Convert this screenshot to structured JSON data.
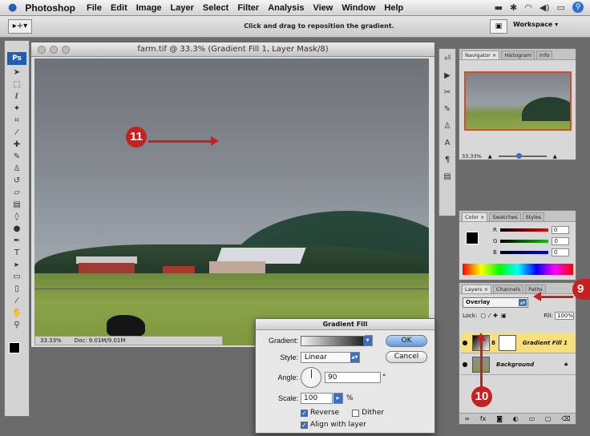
{
  "menubar": {
    "app": "Photoshop",
    "items": [
      "File",
      "Edit",
      "Image",
      "Layer",
      "Select",
      "Filter",
      "Analysis",
      "View",
      "Window",
      "Help"
    ]
  },
  "options_bar": {
    "hint": "Click and drag to reposition the gradient.",
    "workspace": "Workspace ▾"
  },
  "tools": {
    "ps_logo": "Ps"
  },
  "document": {
    "title": "farm.tif @ 33.3% (Gradient Fill 1, Layer Mask/8)",
    "zoom": "33.33%",
    "doc_size": "Doc: 9.01M/9.01M"
  },
  "navigator": {
    "tabs": [
      "Navigator ×",
      "Histogram",
      "Info"
    ],
    "zoom": "33.33%"
  },
  "color_panel": {
    "tabs": [
      "Color ×",
      "Swatches",
      "Styles"
    ],
    "channels": [
      {
        "label": "R",
        "value": "0"
      },
      {
        "label": "G",
        "value": "0"
      },
      {
        "label": "B",
        "value": "0"
      }
    ]
  },
  "layers_panel": {
    "tabs": [
      "Layers ×",
      "Channels",
      "Paths"
    ],
    "blend_mode": "Overlay",
    "lock_label": "Lock:",
    "fill_label": "Fill:",
    "fill_value": "100%",
    "layers": [
      {
        "name": "Gradient Fill 1",
        "selected": true
      },
      {
        "name": "Background",
        "selected": false
      }
    ]
  },
  "dialog": {
    "title": "Gradient Fill",
    "gradient_label": "Gradient:",
    "style_label": "Style:",
    "style_value": "Linear",
    "angle_label": "Angle:",
    "angle_value": "90",
    "angle_unit": "°",
    "scale_label": "Scale:",
    "scale_value": "100",
    "scale_unit": "%",
    "reverse_label": "Reverse",
    "reverse_checked": true,
    "dither_label": "Dither",
    "dither_checked": false,
    "align_label": "Align with layer",
    "align_checked": true,
    "ok_label": "OK",
    "cancel_label": "Cancel"
  },
  "callouts": {
    "step9": "9",
    "step10": "10",
    "step11": "11"
  },
  "colors": {
    "callout": "#c8201c",
    "selected_layer": "#f7e07a",
    "nav_frame": "#d94a2a"
  }
}
